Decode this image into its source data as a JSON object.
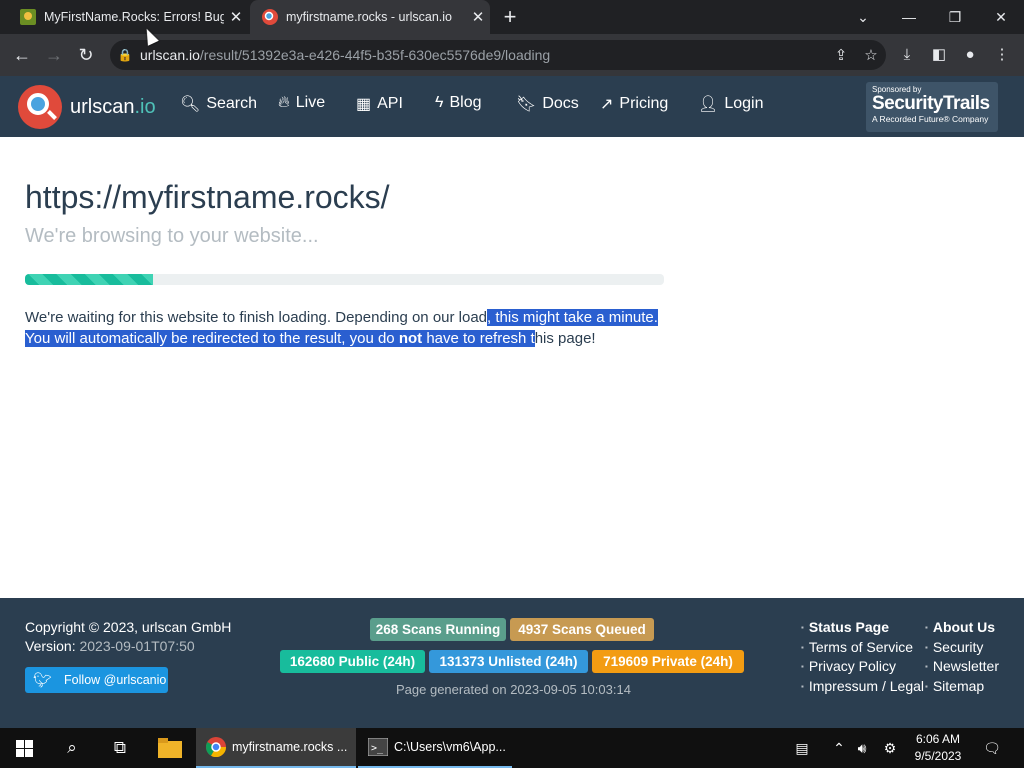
{
  "browser": {
    "tabs": [
      {
        "title": "MyFirstName.Rocks: Errors! Bugs!",
        "active": false
      },
      {
        "title": "myfirstname.rocks - urlscan.io",
        "active": true
      }
    ],
    "new_tab_symbol": "+",
    "url_host": "urlscan.io",
    "url_path": "/result/51392e3a-e426-44f5-b35f-630ec5576de9/loading"
  },
  "navbar": {
    "brand_main": "urlscan",
    "brand_suffix": ".io",
    "links": [
      {
        "label": "Search",
        "icon": "search-icon"
      },
      {
        "label": "Live",
        "icon": "fire-icon"
      },
      {
        "label": "API",
        "icon": "qr-icon"
      },
      {
        "label": "Blog",
        "icon": "bolt-icon"
      },
      {
        "label": "Docs",
        "icon": "bookmark-icon"
      },
      {
        "label": "Pricing",
        "icon": "external-link-icon"
      },
      {
        "label": "Login",
        "icon": "user-icon"
      }
    ],
    "sponsor": {
      "line1": "Sponsored by",
      "line2": "SecurityTrails",
      "line3": "A Recorded Future® Company"
    }
  },
  "main": {
    "site_url": "https://myfirstname.rocks/",
    "subtitle": "We're browsing to your website...",
    "progress": 0.2,
    "message_part1": "We're waiting for this website to finish loading. Depending on our load",
    "message_sel1": ", this might take a minute. You will automatically be redirected to the result, you do ",
    "message_sel_bold": "not",
    "message_sel2": " have to refresh t",
    "message_part2": "his page!"
  },
  "footer": {
    "copyright": "Copyright © 2023, urlscan GmbH",
    "version_label": "Version:",
    "version_value": "2023-09-01T07:50",
    "twitter_label": "Follow @urlscanio",
    "badges": {
      "running": "268 Scans Running",
      "queued": "4937 Scans Queued",
      "public": "162680 Public (24h)",
      "unlisted": "131373 Unlisted (24h)",
      "private": "719609 Private (24h)"
    },
    "generated": "Page generated on 2023-09-05 10:03:14",
    "links_col1": [
      "Status Page",
      "Terms of Service",
      "Privacy Policy",
      "Impressum / Legal"
    ],
    "links_col2": [
      "About Us",
      "Security",
      "Newsletter",
      "Sitemap"
    ]
  },
  "colors": {
    "navbar_bg": "#2b3e50",
    "accent_teal": "#18bc9c",
    "badge_running": "#5a9e8c",
    "badge_queued": "#c79a52",
    "badge_public": "#18bc9c",
    "badge_unlisted": "#3498db",
    "badge_private": "#f39c12",
    "selection": "#2a5fd0"
  },
  "taskbar": {
    "chrome_app": "myfirstname.rocks ...",
    "cmd_app": "C:\\Users\\vm6\\App...",
    "time": "6:06 AM",
    "date": "9/5/2023"
  }
}
